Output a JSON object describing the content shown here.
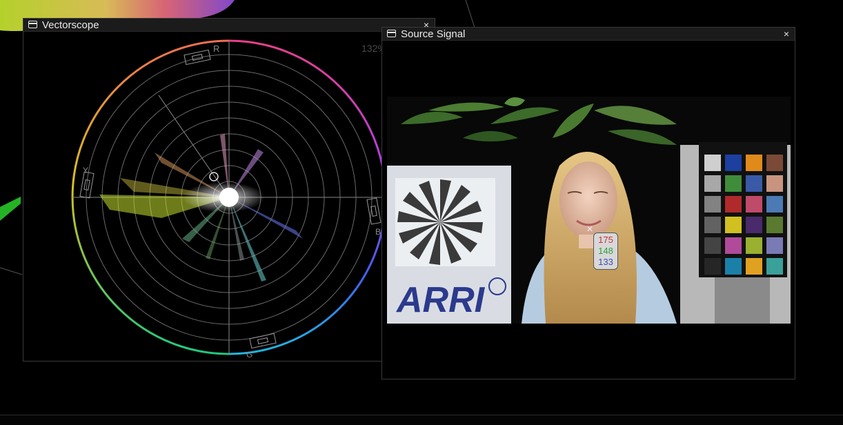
{
  "vectorscope": {
    "title": "Vectorscope",
    "icon": "window-icon",
    "close_glyph": "×",
    "zoom": "132%",
    "targets": {
      "r": "R",
      "y": "Y",
      "b": "B",
      "g": "G"
    }
  },
  "source_signal": {
    "title": "Source Signal",
    "icon": "window-icon",
    "close_glyph": "×",
    "probe": {
      "cross_glyph": "×",
      "r": "175",
      "g": "148",
      "b": "133"
    },
    "image_text": {
      "brand": "ARRI"
    }
  }
}
